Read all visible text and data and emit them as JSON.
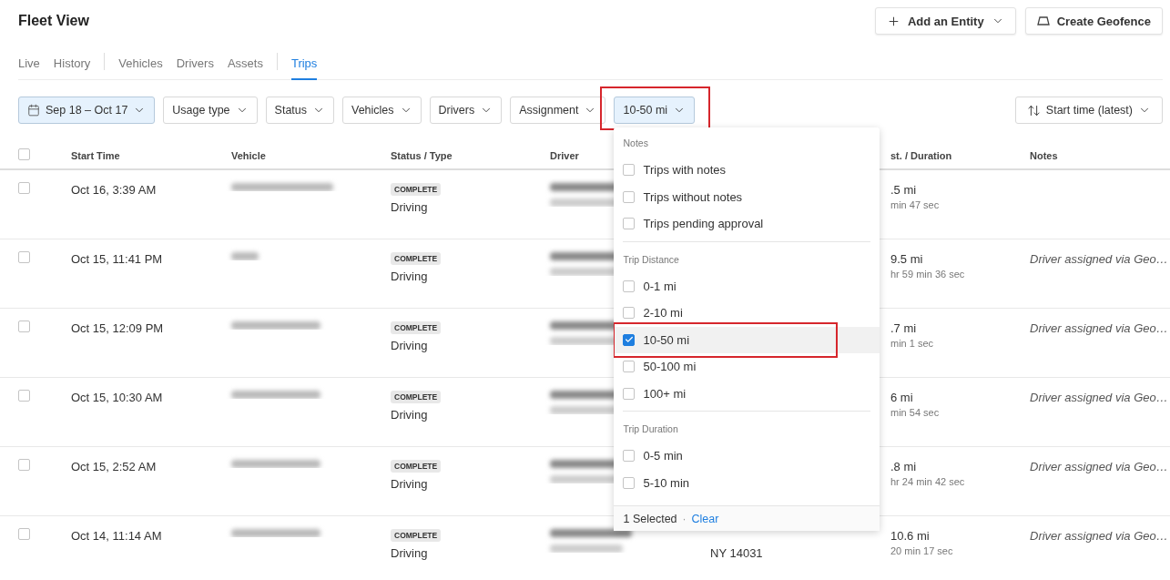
{
  "page": {
    "title": "Fleet View"
  },
  "header_buttons": [
    {
      "label": "Add an Entity",
      "kind": "add",
      "dropdown": true
    },
    {
      "label": "Create Geofence",
      "kind": "geofence",
      "dropdown": false
    }
  ],
  "tab_groups": [
    {
      "tabs": [
        {
          "label": "Live",
          "selected": false
        },
        {
          "label": "History",
          "selected": false
        }
      ]
    },
    {
      "tabs": [
        {
          "label": "Vehicles",
          "selected": false
        },
        {
          "label": "Drivers",
          "selected": false
        },
        {
          "label": "Assets",
          "selected": false
        }
      ]
    },
    {
      "tabs": [
        {
          "label": "Trips",
          "selected": true
        }
      ]
    }
  ],
  "filters": [
    {
      "label": "Sep 18 – Oct 17",
      "kind": "date",
      "active": true,
      "highlighted": false
    },
    {
      "label": "Usage type",
      "kind": "select",
      "active": false,
      "highlighted": false
    },
    {
      "label": "Status",
      "kind": "select",
      "active": false,
      "highlighted": false
    },
    {
      "label": "Vehicles",
      "kind": "select",
      "active": false,
      "highlighted": false
    },
    {
      "label": "Drivers",
      "kind": "select",
      "active": false,
      "highlighted": false
    },
    {
      "label": "Assignment",
      "kind": "select",
      "active": false,
      "highlighted": false
    },
    {
      "label": "10-50 mi",
      "kind": "select",
      "active": true,
      "highlighted": true,
      "open": true
    }
  ],
  "sort": {
    "label": "Start time (latest)"
  },
  "table": {
    "select_all": {
      "checked": false
    },
    "columns": [
      {
        "label": "Start Time"
      },
      {
        "label": "Vehicle"
      },
      {
        "label": "Status / Type"
      },
      {
        "label": "Driver"
      },
      {
        "label": "st. / Duration"
      },
      {
        "label": "Notes"
      }
    ],
    "rows": [
      {
        "checked": false,
        "start_time": "Oct 16, 3:39 AM",
        "status": "COMPLETE",
        "type": "Driving",
        "distance": ".5 mi",
        "duration": "min 47 sec"
      },
      {
        "checked": false,
        "start_time": "Oct 15, 11:41 PM",
        "status": "COMPLETE",
        "type": "Driving",
        "distance": "9.5 mi",
        "duration": "hr 59 min 36 sec",
        "notes": "Driver assigned via Geo…"
      },
      {
        "checked": false,
        "start_time": "Oct 15, 12:09 PM",
        "status": "COMPLETE",
        "type": "Driving",
        "distance": ".7 mi",
        "duration": "min 1 sec",
        "notes": "Driver assigned via Geo…"
      },
      {
        "checked": false,
        "start_time": "Oct 15, 10:30 AM",
        "status": "COMPLETE",
        "type": "Driving",
        "distance": "6 mi",
        "duration": "min 54 sec",
        "notes": "Driver assigned via Geo…"
      },
      {
        "checked": false,
        "start_time": "Oct 15, 2:52 AM",
        "status": "COMPLETE",
        "type": "Driving",
        "distance": ".8 mi",
        "duration": "hr 24 min 42 sec",
        "notes": "Driver assigned via Geo…"
      },
      {
        "checked": false,
        "start_time": "Oct 14, 11:14 AM",
        "status": "COMPLETE",
        "type": "Driving",
        "location": "NY 14031",
        "distance": "10.6 mi",
        "duration": "20 min 17 sec",
        "notes": "Driver assigned via Geo…"
      }
    ]
  },
  "dropdown": {
    "sections": [
      {
        "title": "Notes",
        "options": [
          {
            "label": "Trips with notes",
            "checked": false,
            "highlighted": false
          },
          {
            "label": "Trips without notes",
            "checked": false,
            "highlighted": false
          },
          {
            "label": "Trips pending approval",
            "checked": false,
            "highlighted": false
          }
        ]
      },
      {
        "title": "Trip Distance",
        "options": [
          {
            "label": "0-1 mi",
            "checked": false,
            "highlighted": false
          },
          {
            "label": "2-10 mi",
            "checked": false,
            "highlighted": false
          },
          {
            "label": "10-50 mi",
            "checked": true,
            "highlighted": true
          },
          {
            "label": "50-100 mi",
            "checked": false,
            "highlighted": false
          },
          {
            "label": "100+ mi",
            "checked": false,
            "highlighted": false
          }
        ]
      },
      {
        "title": "Trip Duration",
        "options": [
          {
            "label": "0-5 min",
            "checked": false,
            "highlighted": false
          },
          {
            "label": "5-10 min",
            "checked": false,
            "highlighted": false
          }
        ]
      }
    ],
    "footer": {
      "count": "1 Selected",
      "separator": "·",
      "action": "Clear"
    }
  }
}
